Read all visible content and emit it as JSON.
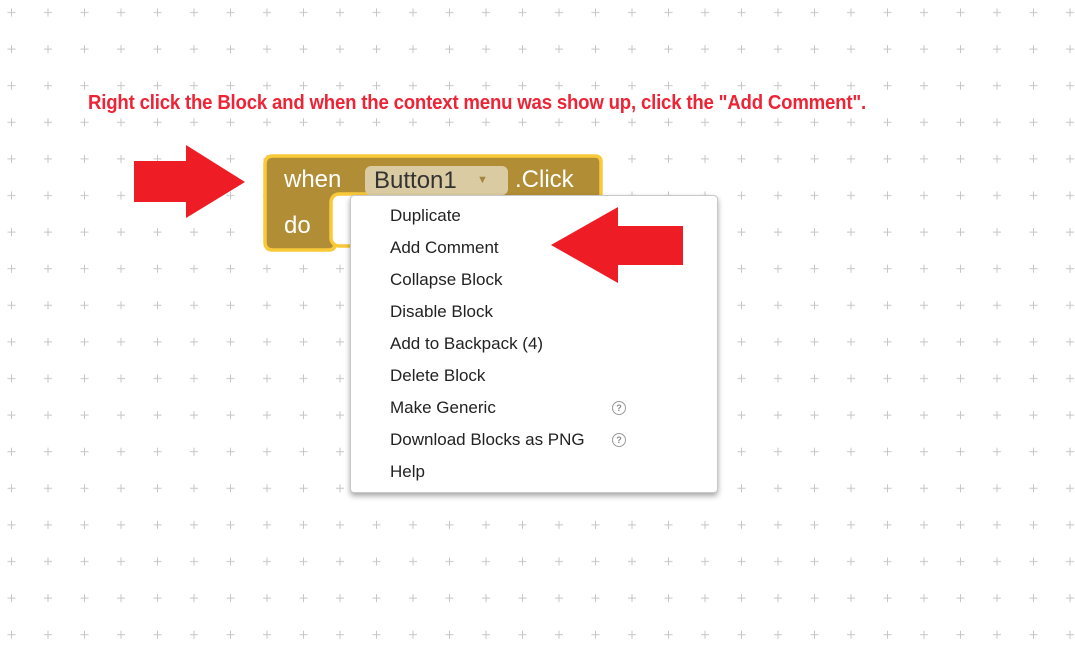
{
  "instruction": "Right click the Block and when the context menu was show up, click the \"Add Comment\".",
  "block": {
    "when_label": "when",
    "component_value": "Button1",
    "dropdown_icon": "triangle-down-icon",
    "event_label": ".Click",
    "do_label": "do",
    "color": "#b18e35",
    "highlight_color": "#f9c93a"
  },
  "context_menu": {
    "items": [
      {
        "label": "Duplicate",
        "has_help": false
      },
      {
        "label": "Add Comment",
        "has_help": false
      },
      {
        "label": "Collapse Block",
        "has_help": false
      },
      {
        "label": "Disable Block",
        "has_help": false
      },
      {
        "label": "Add to Backpack (4)",
        "has_help": false
      },
      {
        "label": "Delete Block",
        "has_help": false
      },
      {
        "label": "Make Generic",
        "has_help": true,
        "help_icon": "?"
      },
      {
        "label": "Download Blocks as PNG",
        "has_help": true,
        "help_icon": "?"
      },
      {
        "label": "Help",
        "has_help": false
      }
    ]
  },
  "colors": {
    "annotation_red": "#ee1c25",
    "grid_mark": "#c6c6c6"
  },
  "icons": {
    "arrow_left_pointer": "arrow-right-icon",
    "arrow_menu_pointer": "arrow-left-icon"
  }
}
